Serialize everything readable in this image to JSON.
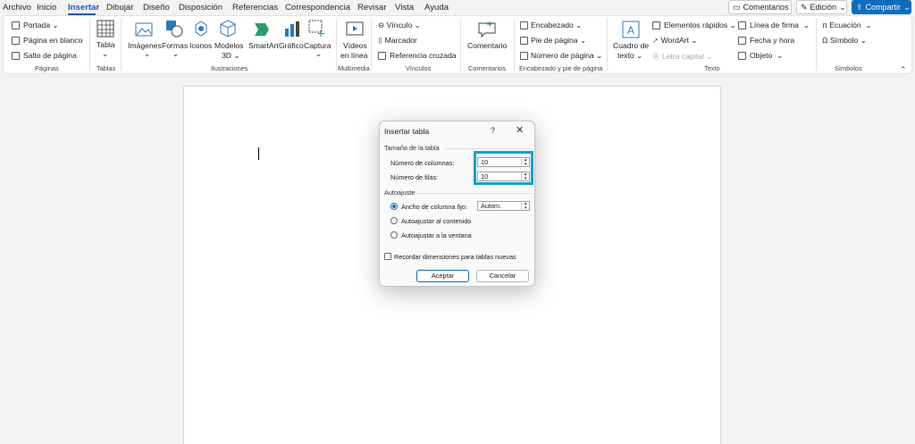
{
  "menu": {
    "tabs": [
      "Archivo",
      "Inicio",
      "Insertar",
      "Dibujar",
      "Diseño",
      "Disposición",
      "Referencias",
      "Correspondencia",
      "Revisar",
      "Vista",
      "Ayuda"
    ],
    "active": "Insertar",
    "comments_label": "Comentarios",
    "editing_label": "Edición",
    "share_label": "Compartir"
  },
  "ribbon": {
    "paginas": {
      "group": "Páginas",
      "portada": "Portada",
      "pagina_blanco": "Página en blanco",
      "salto": "Salto de página"
    },
    "tablas": {
      "group": "Tablas",
      "tabla": "Tabla"
    },
    "ilustraciones": {
      "group": "Ilustraciones",
      "imagenes": "Imágenes",
      "formas": "Formas",
      "iconos": "Iconos",
      "modelos": "Modelos",
      "modelos2": "3D",
      "smartart": "SmartArt",
      "grafico": "Gráfico",
      "captura": "Captura"
    },
    "multimedia": {
      "group": "Multimedia",
      "videos": "Vídeos",
      "videos2": "en línea"
    },
    "vinculos": {
      "group": "Vínculos",
      "vinculo": "Vínculo",
      "marcador": "Marcador",
      "referencia": "Referencia cruzada"
    },
    "comentarios": {
      "group": "Comentarios",
      "comentario": "Comentario"
    },
    "encabezado": {
      "group": "Encabezado y pie de página",
      "encabezado": "Encabezado",
      "pie": "Pie de página",
      "numero": "Número de página"
    },
    "texto": {
      "group": "Texto",
      "cuadro": "Cuadro de",
      "cuadro2": "texto",
      "elementos": "Elementos rápidos",
      "wordart": "WordArt",
      "letra_capital": "Letra capital",
      "linea_firma": "Línea de firma",
      "fecha": "Fecha y hora",
      "objeto": "Objeto"
    },
    "simbolos": {
      "group": "Símbolos",
      "ecuacion": "Ecuación",
      "simbolo": "Símbolo"
    }
  },
  "dialog": {
    "title": "Insertar tabla",
    "help": "?",
    "close": "✕",
    "section_size": "Tamaño de la tabla",
    "columns_label": "Número de columnas:",
    "columns_value": "10",
    "rows_label": "Número de filas:",
    "rows_value": "10",
    "section_autofit": "Autoajuste",
    "fixed_width_label": "Ancho de columna fijo:",
    "fixed_width_value": "Autom.",
    "autofit_content": "Autoajustar al contenido",
    "autofit_window": "Autoajustar a la ventana",
    "remember": "Recordar dimensiones para tablas nuevas",
    "ok": "Aceptar",
    "cancel": "Cancelar"
  }
}
